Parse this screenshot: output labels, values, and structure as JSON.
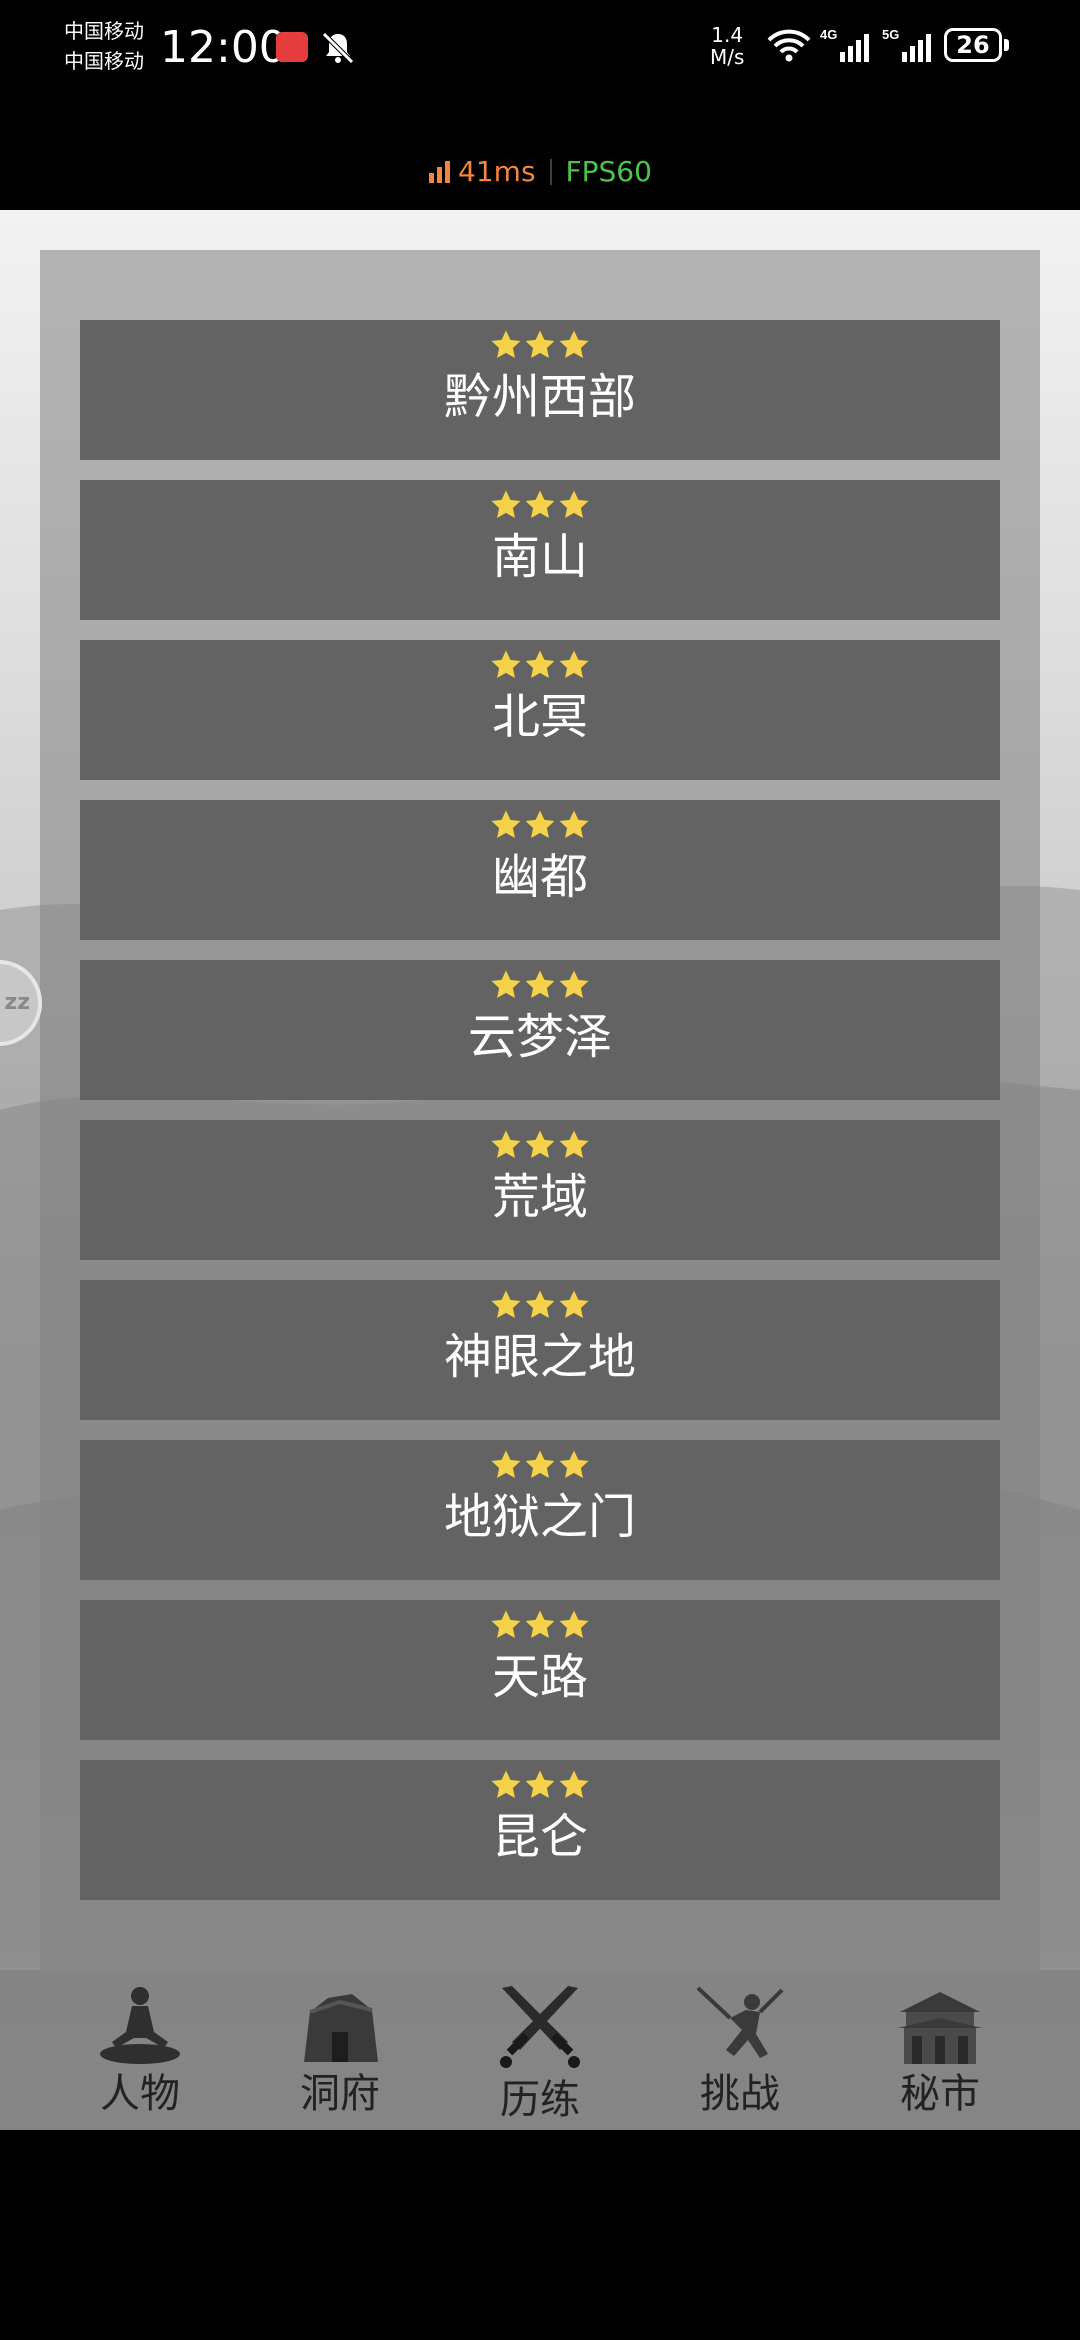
{
  "status_bar": {
    "carrier_1": "中国移动",
    "carrier_2": "中国移动",
    "time": "12:00",
    "speed_value": "1.4",
    "speed_unit": "M/s",
    "net_4g": "4G",
    "net_5g": "5G",
    "battery": "26"
  },
  "perf": {
    "latency": "41ms",
    "fps": "FPS60",
    "latency_color": "#f3843b",
    "fps_color": "#4cc44c"
  },
  "colors": {
    "star": "#f5d24a",
    "item_bg": "#636363"
  },
  "locations": [
    {
      "name": "黔州西部",
      "stars": 3
    },
    {
      "name": "南山",
      "stars": 3
    },
    {
      "name": "北冥",
      "stars": 3
    },
    {
      "name": "幽都",
      "stars": 3
    },
    {
      "name": "云梦泽",
      "stars": 3
    },
    {
      "name": "荒域",
      "stars": 3
    },
    {
      "name": "神眼之地",
      "stars": 3
    },
    {
      "name": "地狱之门",
      "stars": 3
    },
    {
      "name": "天路",
      "stars": 3
    },
    {
      "name": "昆仑",
      "stars": 3
    }
  ],
  "float_button": {
    "label": "zz"
  },
  "nav": [
    {
      "label": "人物",
      "icon": "meditation-icon"
    },
    {
      "label": "洞府",
      "icon": "cave-house-icon"
    },
    {
      "label": "历练",
      "icon": "crossed-swords-icon"
    },
    {
      "label": "挑战",
      "icon": "swordsman-icon"
    },
    {
      "label": "秘市",
      "icon": "market-building-icon"
    }
  ]
}
